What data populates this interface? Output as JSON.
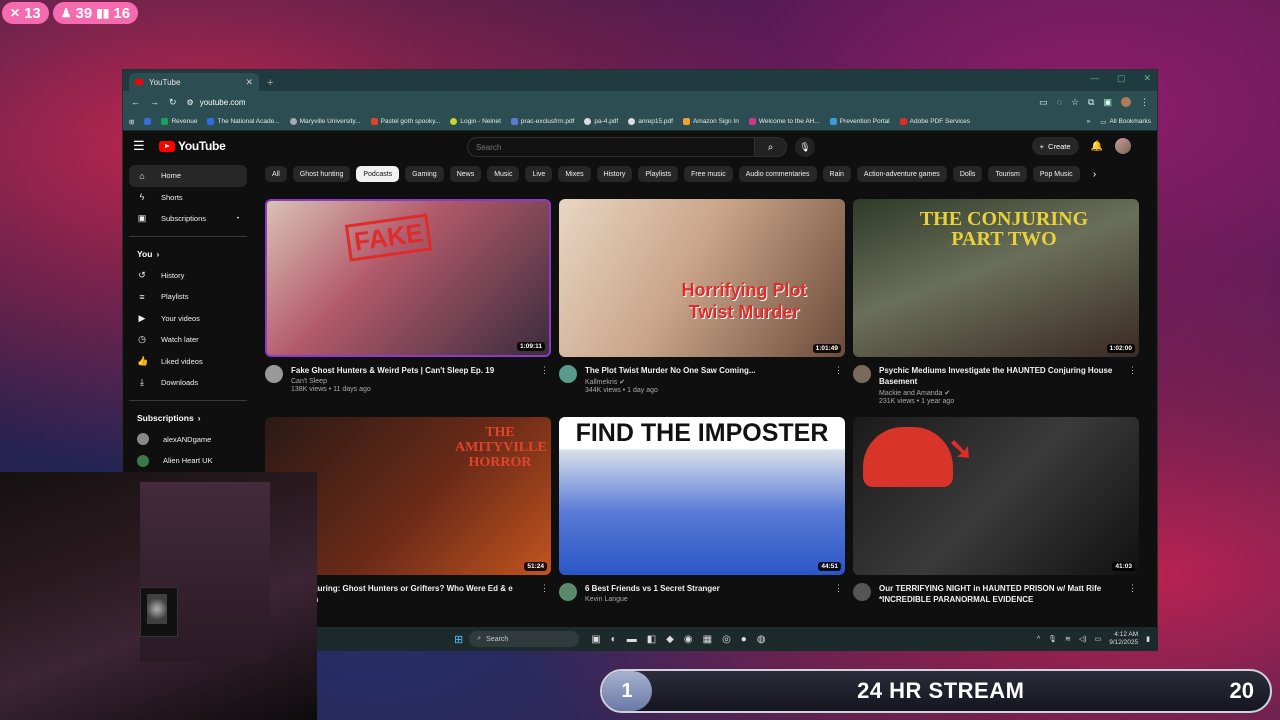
{
  "overlay": {
    "stats": [
      {
        "icon": "kick-icon",
        "value": "13"
      },
      {
        "icon": "followers-icon",
        "value": "39"
      },
      {
        "icon": "viewers-icon",
        "value": "16"
      }
    ],
    "banner": {
      "left_number": "1",
      "title": "24 HR STREAM",
      "right_number": "20"
    }
  },
  "browser": {
    "tab_title": "YouTube",
    "url": "youtube.com",
    "bookmarks": [
      "Revenue",
      "The National Acade...",
      "Maryville University...",
      "Pastel goth spooky...",
      "Login - Nelnet",
      "prac-exclusfrm.pdf",
      "pa-4.pdf",
      "anrep15.pdf",
      "Amazon Sign In",
      "Welcome to the AH...",
      "Prevention Portal",
      "Adobe PDF Services"
    ],
    "all_bookmarks": "All Bookmarks"
  },
  "youtube": {
    "logo": "YouTube",
    "search_placeholder": "Search",
    "create_label": "Create",
    "sidebar": {
      "main": [
        {
          "icon": "home-icon",
          "label": "Home"
        },
        {
          "icon": "shorts-icon",
          "label": "Shorts"
        },
        {
          "icon": "subscriptions-icon",
          "label": "Subscriptions"
        }
      ],
      "you_heading": "You",
      "you_items": [
        {
          "icon": "history-icon",
          "label": "History"
        },
        {
          "icon": "playlists-icon",
          "label": "Playlists"
        },
        {
          "icon": "your-videos-icon",
          "label": "Your videos"
        },
        {
          "icon": "watch-later-icon",
          "label": "Watch later"
        },
        {
          "icon": "liked-icon",
          "label": "Liked videos"
        },
        {
          "icon": "downloads-icon",
          "label": "Downloads"
        }
      ],
      "subs_heading": "Subscriptions",
      "subs": [
        "alexANDgame",
        "Alien Heart UK"
      ]
    },
    "chips": [
      "All",
      "Ghost hunting",
      "Podcasts",
      "Gaming",
      "News",
      "Music",
      "Live",
      "Mixes",
      "History",
      "Playlists",
      "Free music",
      "Audio commentaries",
      "Rain",
      "Action-adventure games",
      "Dolls",
      "Tourism",
      "Pop Music"
    ],
    "active_chip": "Podcasts",
    "videos": [
      {
        "title": "Fake Ghost Hunters & Weird Pets | Can't Sleep Ep. 19",
        "channel": "Can't Sleep",
        "stats": "138K views • 11 days ago",
        "duration": "1:09:11",
        "thumb_text": "FAKE"
      },
      {
        "title": "The Plot Twist Murder No One Saw Coming...",
        "channel": "Kallmekris",
        "stats": "344K views • 1 day ago",
        "duration": "1:01:49",
        "thumb_text": "Horrifying Plot Twist Murder"
      },
      {
        "title": "Psychic Mediums Investigate the HAUNTED Conjuring House Basement",
        "channel": "Mackie and Amanda",
        "stats": "231K views • 1 year ago",
        "duration": "1:02:00",
        "thumb_text": "THE CONJURING PART TWO"
      },
      {
        "title": "al Conjuring: Ghost Hunters or Grifters? Who Were Ed & e Warren",
        "channel": "",
        "stats": "",
        "duration": "51:24",
        "thumb_text": "THE AMITYVILLE HORROR"
      },
      {
        "title": "6 Best Friends vs 1 Secret Stranger",
        "channel": "Kevin Langue",
        "stats": "",
        "duration": "44:51",
        "thumb_text": "FIND THE IMPOSTER"
      },
      {
        "title": "Our TERRIFYING NIGHT in HAUNTED PRISON w/ Matt Rife *INCREDIBLE PARANORMAL EVIDENCE",
        "channel": "",
        "stats": "",
        "duration": "41:03",
        "thumb_text": ""
      }
    ]
  },
  "taskbar": {
    "search": "Search",
    "time": "4:12 AM",
    "date": "9/12/2025"
  }
}
